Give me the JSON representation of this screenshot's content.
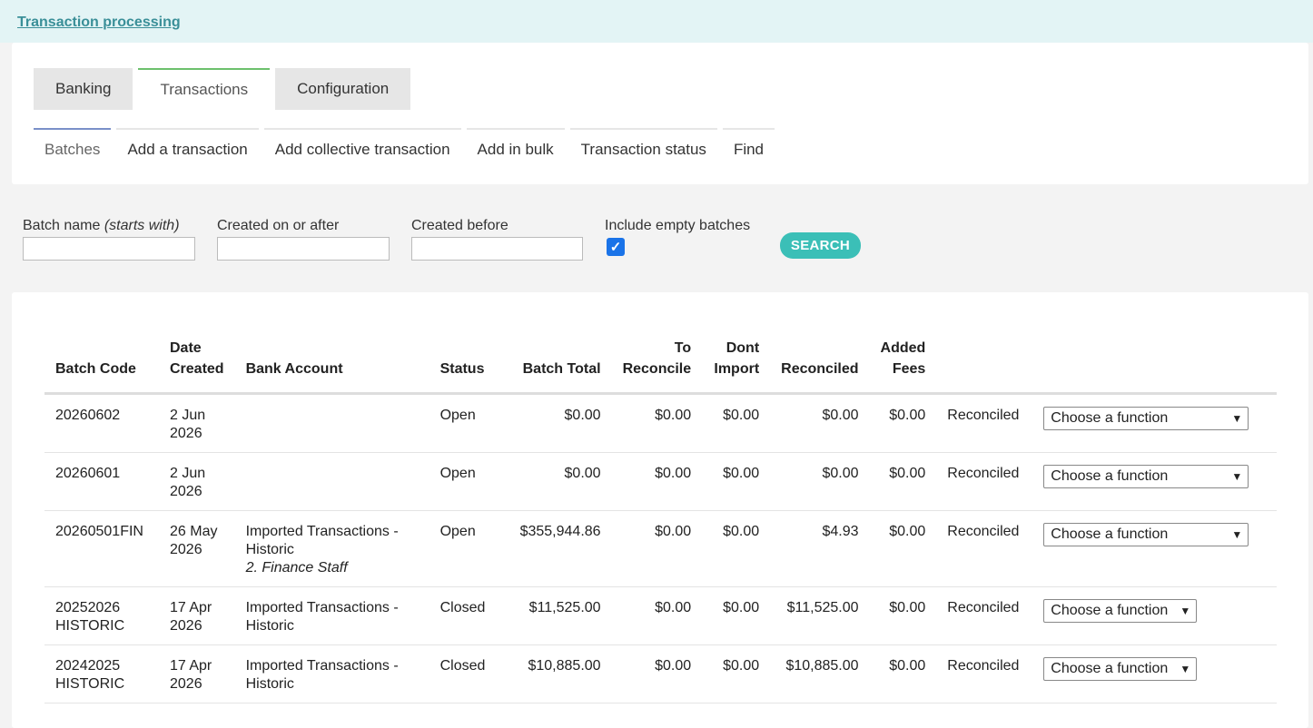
{
  "header": {
    "title": "Transaction processing"
  },
  "tabs": [
    {
      "label": "Banking",
      "active": false
    },
    {
      "label": "Transactions",
      "active": true
    },
    {
      "label": "Configuration",
      "active": false
    }
  ],
  "subtabs": [
    {
      "label": "Batches",
      "active": true
    },
    {
      "label": "Add a transaction",
      "active": false
    },
    {
      "label": "Add collective transaction",
      "active": false
    },
    {
      "label": "Add in bulk",
      "active": false
    },
    {
      "label": "Transaction status",
      "active": false
    },
    {
      "label": "Find",
      "active": false
    }
  ],
  "filters": {
    "batch_name_label": "Batch name",
    "batch_name_hint": "(starts with)",
    "batch_name_value": "",
    "created_after_label": "Created on or after",
    "created_after_value": "",
    "created_before_label": "Created before",
    "created_before_value": "",
    "include_empty_label": "Include empty batches",
    "include_empty_checked": true,
    "search_label": "SEARCH"
  },
  "table": {
    "headers": {
      "batch_code": "Batch Code",
      "date_created_1": "Date",
      "date_created_2": "Created",
      "bank_account": "Bank Account",
      "status": "Status",
      "batch_total": "Batch Total",
      "to_reconcile_1": "To",
      "to_reconcile_2": "Reconcile",
      "dont_import_1": "Dont",
      "dont_import_2": "Import",
      "reconciled": "Reconciled",
      "added_fees_1": "Added",
      "added_fees_2": "Fees"
    },
    "rows": [
      {
        "code1": "20260602",
        "code2": "",
        "date1": "2 Jun",
        "date2": "2026",
        "bank1": "",
        "bank2": "",
        "bank3": "",
        "status": "Open",
        "total": "$0.00",
        "to_reconcile": "$0.00",
        "dont_import": "$0.00",
        "reconciled": "$0.00",
        "fees": "$0.00",
        "state": "Reconciled",
        "function": "Choose a function"
      },
      {
        "code1": "20260601",
        "code2": "",
        "date1": "2 Jun",
        "date2": "2026",
        "bank1": "",
        "bank2": "",
        "bank3": "",
        "status": "Open",
        "total": "$0.00",
        "to_reconcile": "$0.00",
        "dont_import": "$0.00",
        "reconciled": "$0.00",
        "fees": "$0.00",
        "state": "Reconciled",
        "function": "Choose a function"
      },
      {
        "code1": "20260501FIN",
        "code2": "",
        "date1": "26 May",
        "date2": "2026",
        "bank1": "Imported Transactions -",
        "bank2": "Historic",
        "bank3": "2. Finance Staff",
        "status": "Open",
        "total": "$355,944.86",
        "to_reconcile": "$0.00",
        "dont_import": "$0.00",
        "reconciled": "$4.93",
        "fees": "$0.00",
        "state": "Reconciled",
        "function": "Choose a function"
      },
      {
        "code1": "20252026",
        "code2": "HISTORIC",
        "date1": "17 Apr",
        "date2": "2026",
        "bank1": "Imported Transactions -",
        "bank2": "Historic",
        "bank3": "",
        "status": "Closed",
        "total": "$11,525.00",
        "to_reconcile": "$0.00",
        "dont_import": "$0.00",
        "reconciled": "$11,525.00",
        "fees": "$0.00",
        "state": "Reconciled",
        "function": "Choose a function"
      },
      {
        "code1": "20242025",
        "code2": "HISTORIC",
        "date1": "17 Apr",
        "date2": "2026",
        "bank1": "Imported Transactions -",
        "bank2": "Historic",
        "bank3": "",
        "status": "Closed",
        "total": "$10,885.00",
        "to_reconcile": "$0.00",
        "dont_import": "$0.00",
        "reconciled": "$10,885.00",
        "fees": "$0.00",
        "state": "Reconciled",
        "function": "Choose a function"
      }
    ]
  },
  "icons": {
    "dropdown": "chevron-down-icon",
    "checkbox": "checkmark-icon"
  },
  "colors": {
    "accent": "#3bbfb7",
    "link": "#3a8f98",
    "checkbox": "#1a73e8",
    "active_tab_border": "#6cc06c"
  }
}
